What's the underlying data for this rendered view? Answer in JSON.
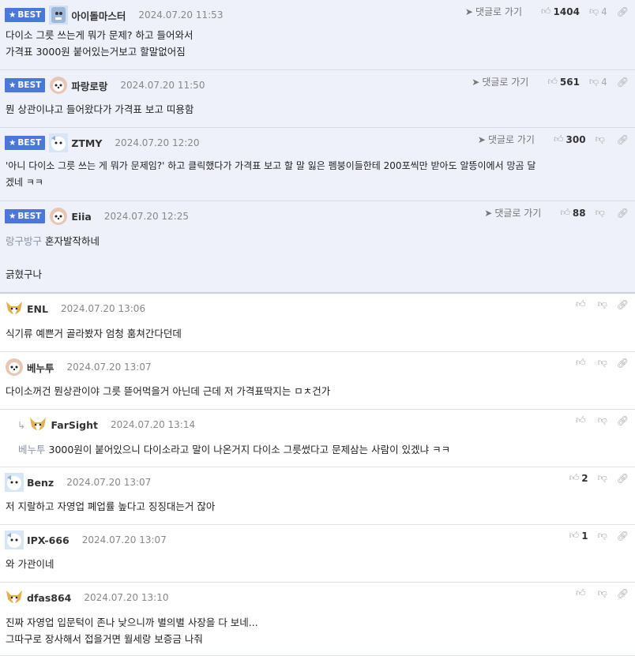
{
  "ui": {
    "best_label": "BEST",
    "reply_label": "댓글로 가기"
  },
  "comments": [
    {
      "nick": "아이돌마스터",
      "date": "2024.07.20 11:53",
      "up": "1404",
      "down": "4",
      "lines": [
        "다이소 그릇 쓰는게 뭐가 문제? 하고 들어와서",
        "가격표 3000원 붙어있는거보고 할말없어짐"
      ]
    },
    {
      "nick": "파랑로랑",
      "date": "2024.07.20 11:50",
      "up": "561",
      "down": "4",
      "lines": [
        "뭔 상관이냐고 들어왔다가 가격표 보고 띠용함"
      ]
    },
    {
      "nick": "ZTMY",
      "date": "2024.07.20 12:20",
      "up": "300",
      "down": "",
      "lines": [
        "'아니 다이소 그릇 쓰는 게 뭐가 문제임?' 하고 클릭했다가 가격표 보고 할 말 잃은 펨붕이들한테 200포씩만 받아도 알뜽이에서 망곰 달",
        "겠네 ㅋㅋ"
      ]
    },
    {
      "nick": "Eiia",
      "date": "2024.07.20 12:25",
      "up": "88",
      "down": "",
      "mention": "랑구방구",
      "lines": [
        "혼자발작하네",
        "",
        "긁혔구나"
      ]
    },
    {
      "nick": "ENL",
      "date": "2024.07.20 13:06",
      "up": "",
      "down": "",
      "lines": [
        "식기류 예쁜거 골라봤자 엄청 훔쳐간다던데"
      ]
    },
    {
      "nick": "베누투",
      "date": "2024.07.20 13:07",
      "up": "",
      "down": "",
      "lines": [
        "다이소꺼건 뭔상관이야 그릇 뜯어먹을거 아닌데 근데 저 가격표딱지는 ㅁㅊ건가"
      ]
    },
    {
      "nick": "FarSight",
      "date": "2024.07.20 13:14",
      "up": "",
      "down": "",
      "mention": "베누투",
      "lines": [
        "3000원이 붙어있으니 다이소라고 말이 나온거지 다이소 그릇썼다고 문제삼는 사람이 있겠냐 ㅋㅋ"
      ]
    },
    {
      "nick": "Benz",
      "date": "2024.07.20 13:07",
      "up": "2",
      "down": "",
      "lines": [
        "저 지랄하고 자영업 폐업률 높다고 징징대는거 잖아"
      ]
    },
    {
      "nick": "IPX-666",
      "date": "2024.07.20 13:07",
      "up": "1",
      "down": "",
      "lines": [
        "와 가관이네"
      ]
    },
    {
      "nick": "dfas864",
      "date": "2024.07.20 13:10",
      "up": "",
      "down": "",
      "lines": [
        "진짜 자영업 입문턱이 존나 낮으니까 별의별 사장을 다 보네...",
        "그따구로 장사해서 접을거면 월세랑 보증금 나줘"
      ]
    }
  ]
}
